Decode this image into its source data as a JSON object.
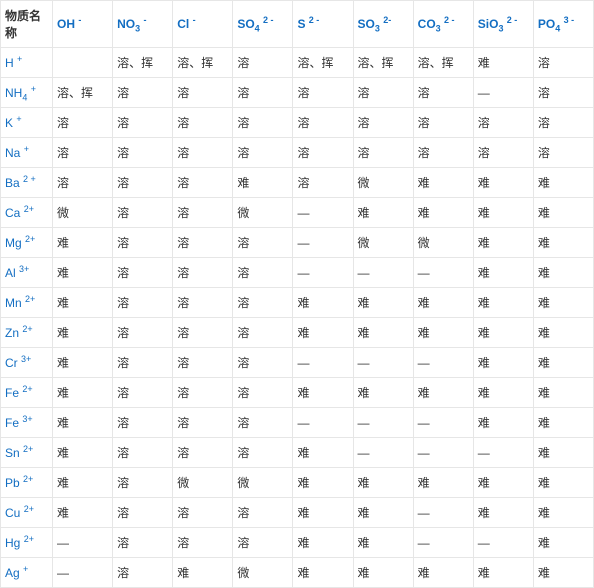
{
  "header_label": "物质名称",
  "columns": [
    {
      "base": "OH",
      "sup": "-"
    },
    {
      "base": "NO",
      "sub": "3",
      "sup": "-"
    },
    {
      "base": "Cl",
      "sup": "-"
    },
    {
      "base": "SO",
      "sub": "4",
      "sup": "2 -"
    },
    {
      "base": "S",
      "sup": "2 -"
    },
    {
      "base": "SO",
      "sub": "3",
      "sup": "2-"
    },
    {
      "base": "CO",
      "sub": "3",
      "sup": "2 -"
    },
    {
      "base": "SiO",
      "sub": "3",
      "sup": "2 -"
    },
    {
      "base": "PO",
      "sub": "4",
      "sup": "3 -"
    }
  ],
  "rows": [
    {
      "ion": {
        "base": "H",
        "sup": "+"
      },
      "cells": [
        "",
        "溶、挥",
        "溶、挥",
        "溶",
        "溶、挥",
        "溶、挥",
        "溶、挥",
        "难",
        "溶"
      ]
    },
    {
      "ion": {
        "base": "NH",
        "sub": "4",
        "sup": "+"
      },
      "cells": [
        "溶、挥",
        "溶",
        "溶",
        "溶",
        "溶",
        "溶",
        "溶",
        "—",
        "溶"
      ]
    },
    {
      "ion": {
        "base": "K",
        "sup": "+"
      },
      "cells": [
        "溶",
        "溶",
        "溶",
        "溶",
        "溶",
        "溶",
        "溶",
        "溶",
        "溶"
      ]
    },
    {
      "ion": {
        "base": "Na",
        "sup": "+"
      },
      "cells": [
        "溶",
        "溶",
        "溶",
        "溶",
        "溶",
        "溶",
        "溶",
        "溶",
        "溶"
      ]
    },
    {
      "ion": {
        "base": "Ba",
        "sup": "2 +"
      },
      "cells": [
        "溶",
        "溶",
        "溶",
        "难",
        "溶",
        "微",
        "难",
        "难",
        "难"
      ]
    },
    {
      "ion": {
        "base": "Ca",
        "sup": "2+"
      },
      "cells": [
        "微",
        "溶",
        "溶",
        "微",
        "—",
        "难",
        "难",
        "难",
        "难"
      ]
    },
    {
      "ion": {
        "base": "Mg",
        "sup": "2+"
      },
      "cells": [
        "难",
        "溶",
        "溶",
        "溶",
        "—",
        "微",
        "微",
        "难",
        "难"
      ]
    },
    {
      "ion": {
        "base": "Al",
        "sup": "3+"
      },
      "cells": [
        "难",
        "溶",
        "溶",
        "溶",
        "—",
        "—",
        "—",
        "难",
        "难"
      ]
    },
    {
      "ion": {
        "base": "Mn",
        "sup": "2+"
      },
      "cells": [
        "难",
        "溶",
        "溶",
        "溶",
        "难",
        "难",
        "难",
        "难",
        "难"
      ]
    },
    {
      "ion": {
        "base": "Zn",
        "sup": "2+"
      },
      "cells": [
        "难",
        "溶",
        "溶",
        "溶",
        "难",
        "难",
        "难",
        "难",
        "难"
      ]
    },
    {
      "ion": {
        "base": "Cr",
        "sup": "3+"
      },
      "cells": [
        "难",
        "溶",
        "溶",
        "溶",
        "—",
        "—",
        "—",
        "难",
        "难"
      ]
    },
    {
      "ion": {
        "base": "Fe",
        "sup": "2+"
      },
      "cells": [
        "难",
        "溶",
        "溶",
        "溶",
        "难",
        "难",
        "难",
        "难",
        "难"
      ]
    },
    {
      "ion": {
        "base": "Fe",
        "sup": "3+"
      },
      "cells": [
        "难",
        "溶",
        "溶",
        "溶",
        "—",
        "—",
        "—",
        "难",
        "难"
      ]
    },
    {
      "ion": {
        "base": "Sn",
        "sup": "2+"
      },
      "cells": [
        "难",
        "溶",
        "溶",
        "溶",
        "难",
        "—",
        "—",
        "—",
        "难"
      ]
    },
    {
      "ion": {
        "base": "Pb",
        "sup": "2+"
      },
      "cells": [
        "难",
        "溶",
        "微",
        "微",
        "难",
        "难",
        "难",
        "难",
        "难"
      ]
    },
    {
      "ion": {
        "base": "Cu",
        "sup": "2+"
      },
      "cells": [
        "难",
        "溶",
        "溶",
        "溶",
        "难",
        "难",
        "—",
        "难",
        "难"
      ]
    },
    {
      "ion": {
        "base": "Hg",
        "sup": "2+"
      },
      "cells": [
        "—",
        "溶",
        "溶",
        "溶",
        "难",
        "难",
        "—",
        "—",
        "难"
      ]
    },
    {
      "ion": {
        "base": "Ag",
        "sup": "+"
      },
      "cells": [
        "—",
        "溶",
        "难",
        "微",
        "难",
        "难",
        "难",
        "难",
        "难"
      ]
    }
  ]
}
